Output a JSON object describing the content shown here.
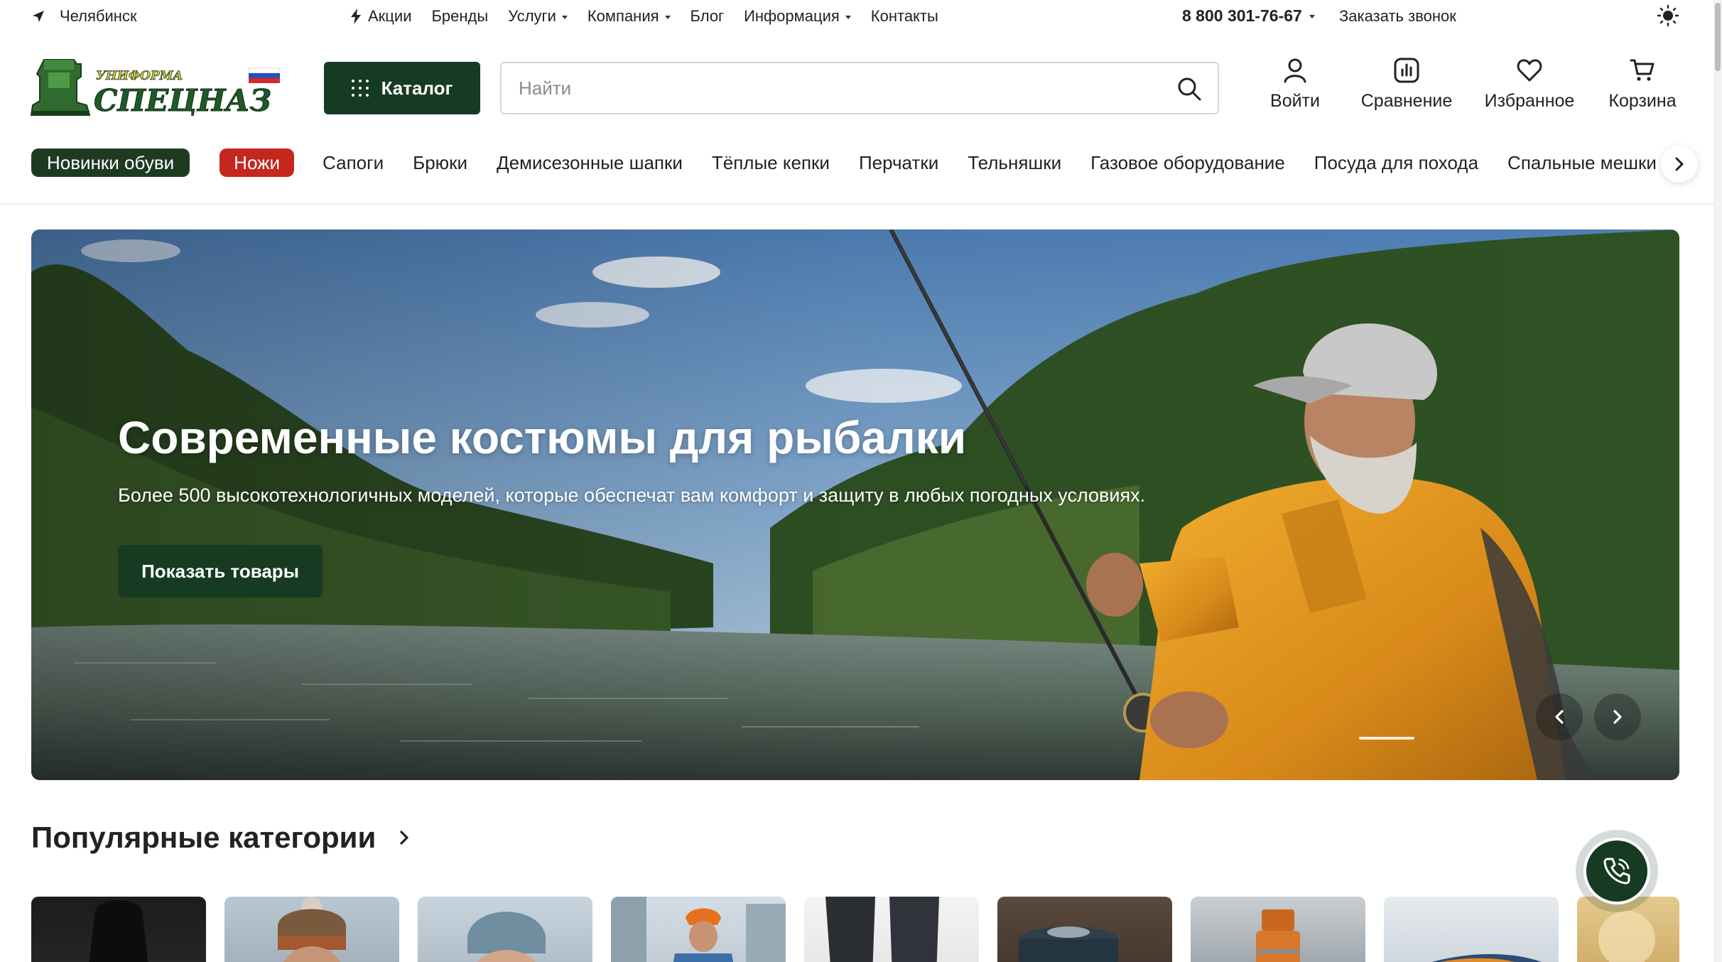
{
  "topbar": {
    "city": "Челябинск",
    "nav": [
      {
        "label": "Акции",
        "icon": "lightning-icon",
        "dropdown": false
      },
      {
        "label": "Бренды",
        "dropdown": false
      },
      {
        "label": "Услуги",
        "dropdown": true
      },
      {
        "label": "Компания",
        "dropdown": true
      },
      {
        "label": "Блог",
        "dropdown": false
      },
      {
        "label": "Информация",
        "dropdown": true
      },
      {
        "label": "Контакты",
        "dropdown": false
      }
    ],
    "phone": "8 800 301-76-67",
    "callback": "Заказать звонок"
  },
  "header": {
    "logo": {
      "top_text": "УНИФОРМА",
      "main_text": "СПЕЦНАЗ"
    },
    "catalog_label": "Каталог",
    "search_placeholder": "Найти",
    "icons": [
      {
        "label": "Войти",
        "icon": "user-icon"
      },
      {
        "label": "Сравнение",
        "icon": "compare-chart-icon"
      },
      {
        "label": "Избранное",
        "icon": "heart-icon"
      },
      {
        "label": "Корзина",
        "icon": "cart-icon"
      }
    ]
  },
  "chips": [
    {
      "label": "Новинки обуви",
      "style": "green"
    },
    {
      "label": "Ножи",
      "style": "red"
    },
    {
      "label": "Сапоги",
      "style": "plain"
    },
    {
      "label": "Брюки",
      "style": "plain"
    },
    {
      "label": "Демисезонные шапки",
      "style": "plain"
    },
    {
      "label": "Тёплые кепки",
      "style": "plain"
    },
    {
      "label": "Перчатки",
      "style": "plain"
    },
    {
      "label": "Тельняшки",
      "style": "plain"
    },
    {
      "label": "Газовое оборудование",
      "style": "plain"
    },
    {
      "label": "Посуда для похода",
      "style": "plain"
    },
    {
      "label": "Спальные мешки",
      "style": "plain"
    }
  ],
  "hero": {
    "title": "Современные костюмы для рыбалки",
    "subtitle": "Более 500 высокотехнологичных моделей, которые обеспечат вам комфорт и защиту в любых погодных условиях.",
    "cta": "Показать товары"
  },
  "popular": {
    "title": "Популярные категории"
  },
  "colors": {
    "brand_green": "#163a22",
    "chip_green": "#1e3b22",
    "chip_red": "#c3271d",
    "jacket_orange": "#e0951f"
  }
}
